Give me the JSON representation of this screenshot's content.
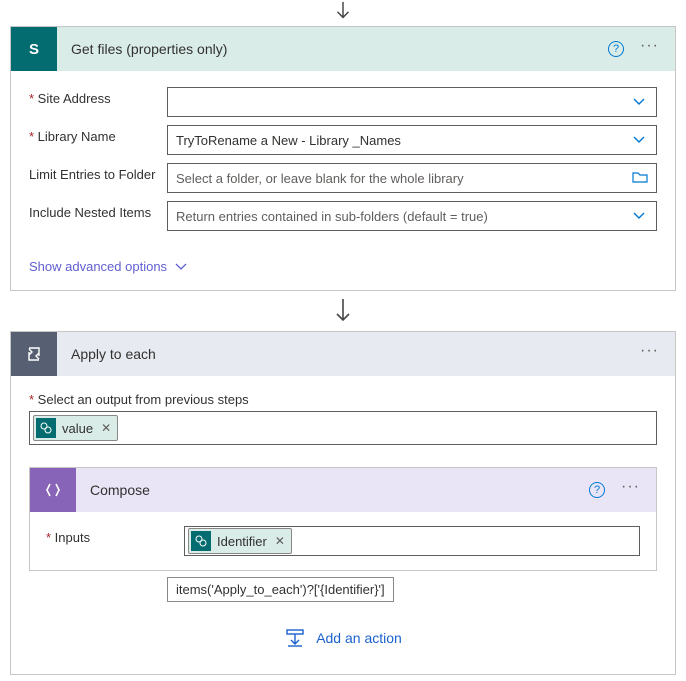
{
  "getFiles": {
    "title": "Get files (properties only)",
    "fields": {
      "siteAddress": {
        "label": "Site Address",
        "value": ""
      },
      "libraryName": {
        "label": "Library Name",
        "value": "TryToRename a New - Library _Names"
      },
      "limitFolder": {
        "label": "Limit Entries to Folder",
        "placeholder": "Select a folder, or leave blank for the whole library"
      },
      "nested": {
        "label": "Include Nested Items",
        "placeholder": "Return entries contained in sub-folders (default = true)"
      }
    },
    "advanced": "Show advanced options"
  },
  "applyToEach": {
    "title": "Apply to each",
    "selectLabel": "Select an output from previous steps",
    "token": "value"
  },
  "compose": {
    "title": "Compose",
    "inputsLabel": "Inputs",
    "token": "Identifier",
    "expression": "items('Apply_to_each')?['{Identifier}']"
  },
  "addAction": "Add an action",
  "icons": {
    "sharepointLetter": "S"
  }
}
